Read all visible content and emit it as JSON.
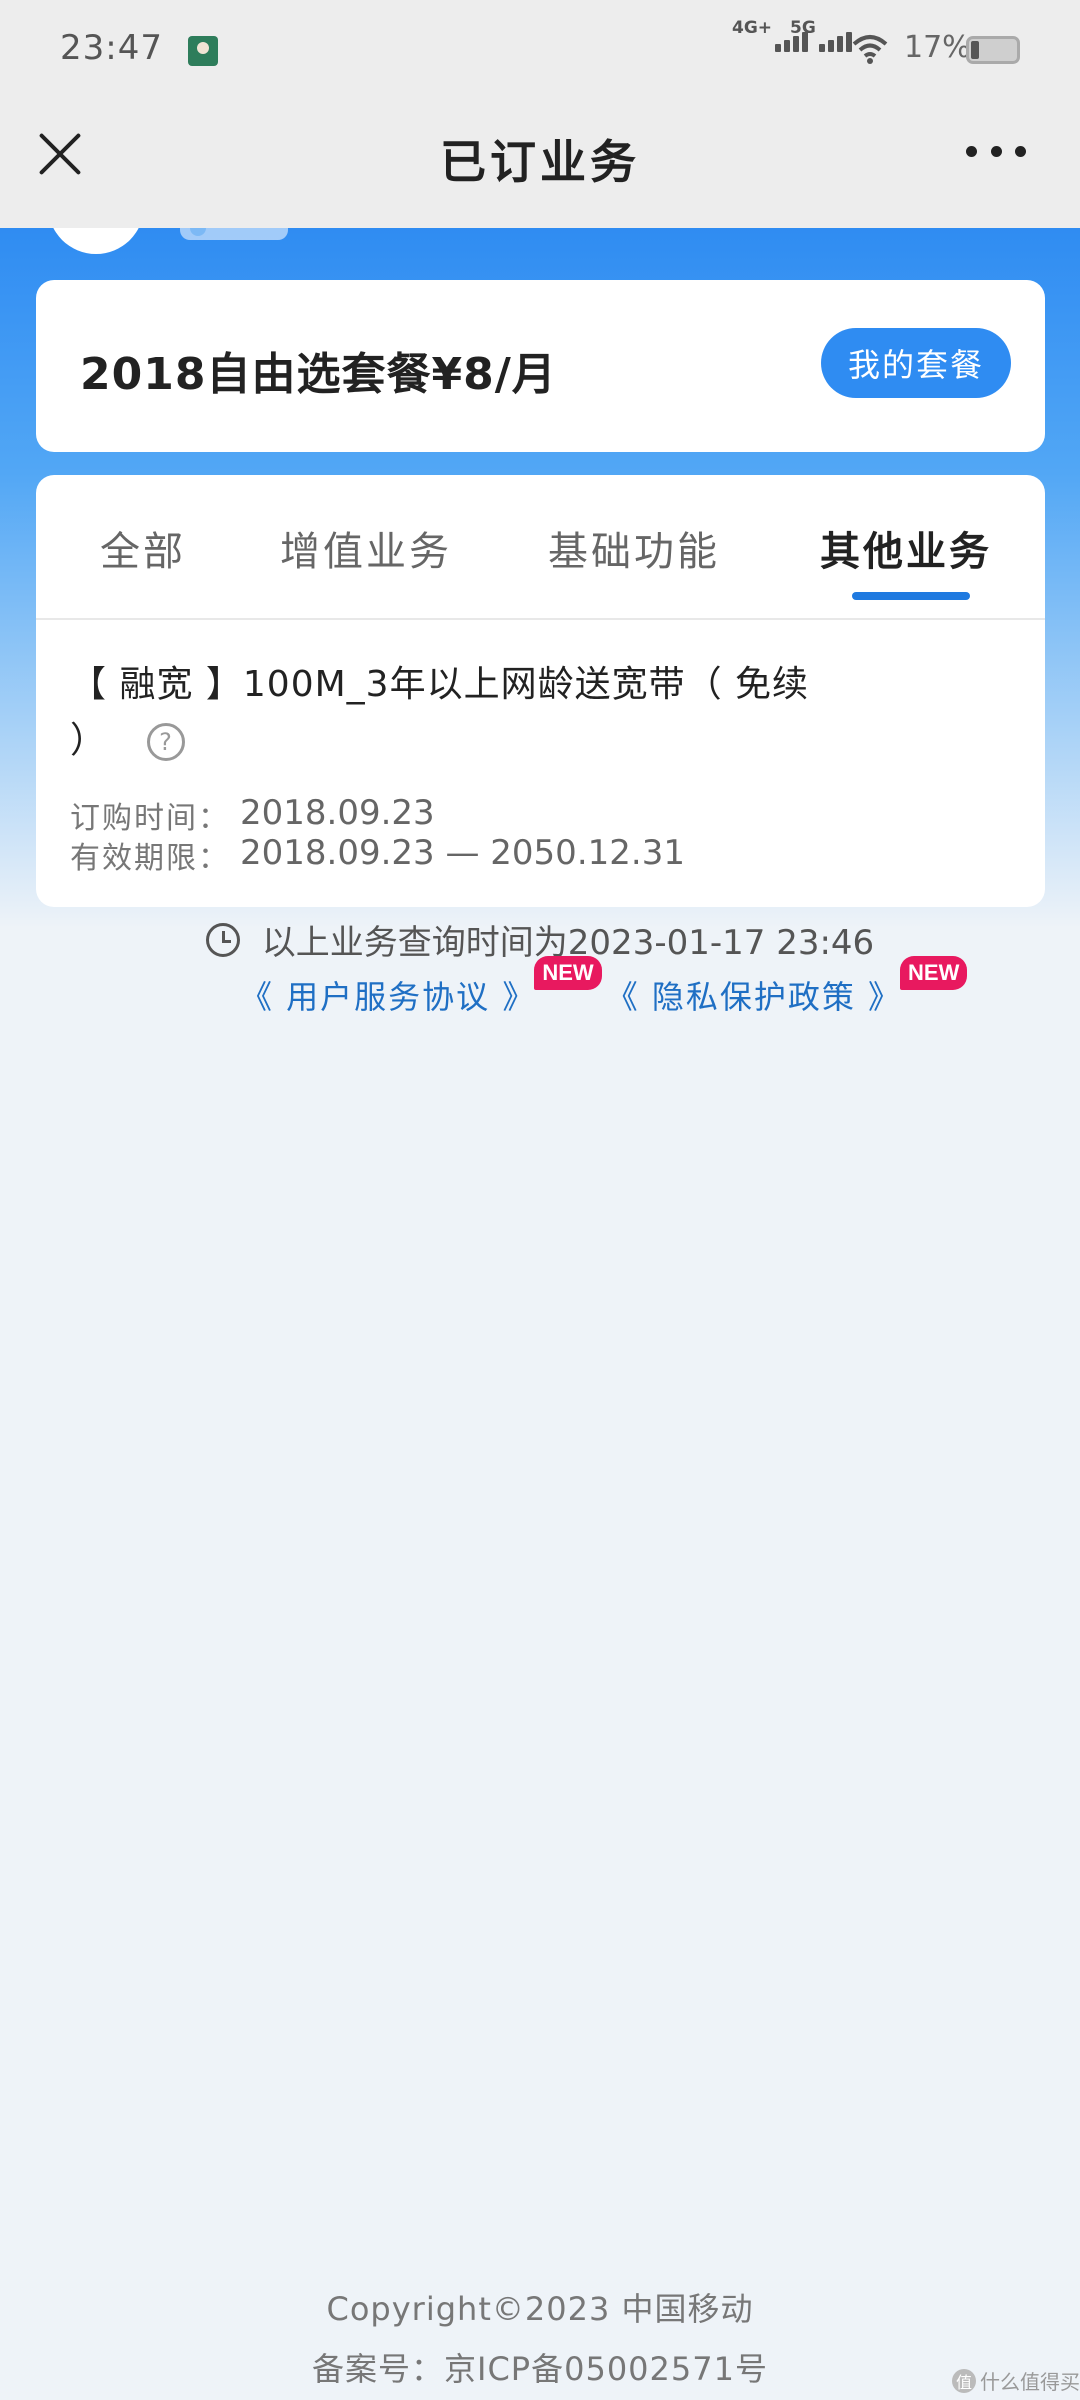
{
  "status_bar": {
    "time": "23:47",
    "network1": "4G+",
    "network2": "5G",
    "battery": "17%"
  },
  "nav": {
    "title": "已订业务"
  },
  "plan": {
    "name": "2018自由选套餐¥8/月",
    "button": "我的套餐"
  },
  "tabs": [
    {
      "label": "全部"
    },
    {
      "label": "增值业务"
    },
    {
      "label": "基础功能"
    },
    {
      "label": "其他业务"
    }
  ],
  "active_tab": "其他业务",
  "service_item": {
    "title": "【 融宽 】100M_3年以上网龄送宽带（ 免续 ）",
    "help": "?",
    "purchase_label": "订购时间：",
    "purchase_value": "2018.09.23",
    "validity_label": "有效期限：",
    "validity_value": "2018.09.23 — 2050.12.31"
  },
  "footer": {
    "query_time": "以上业务查询时间为2023-01-17 23:46",
    "user_agreement": "《 用户服务协议 》",
    "privacy_policy": "《 隐私保护政策 》",
    "new_badge": "NEW",
    "copyright": "Copyright©2023 中国移动",
    "icp": "备案号：京ICP备05002571号",
    "watermark": "什么值得买",
    "watermark_logo": "值"
  }
}
